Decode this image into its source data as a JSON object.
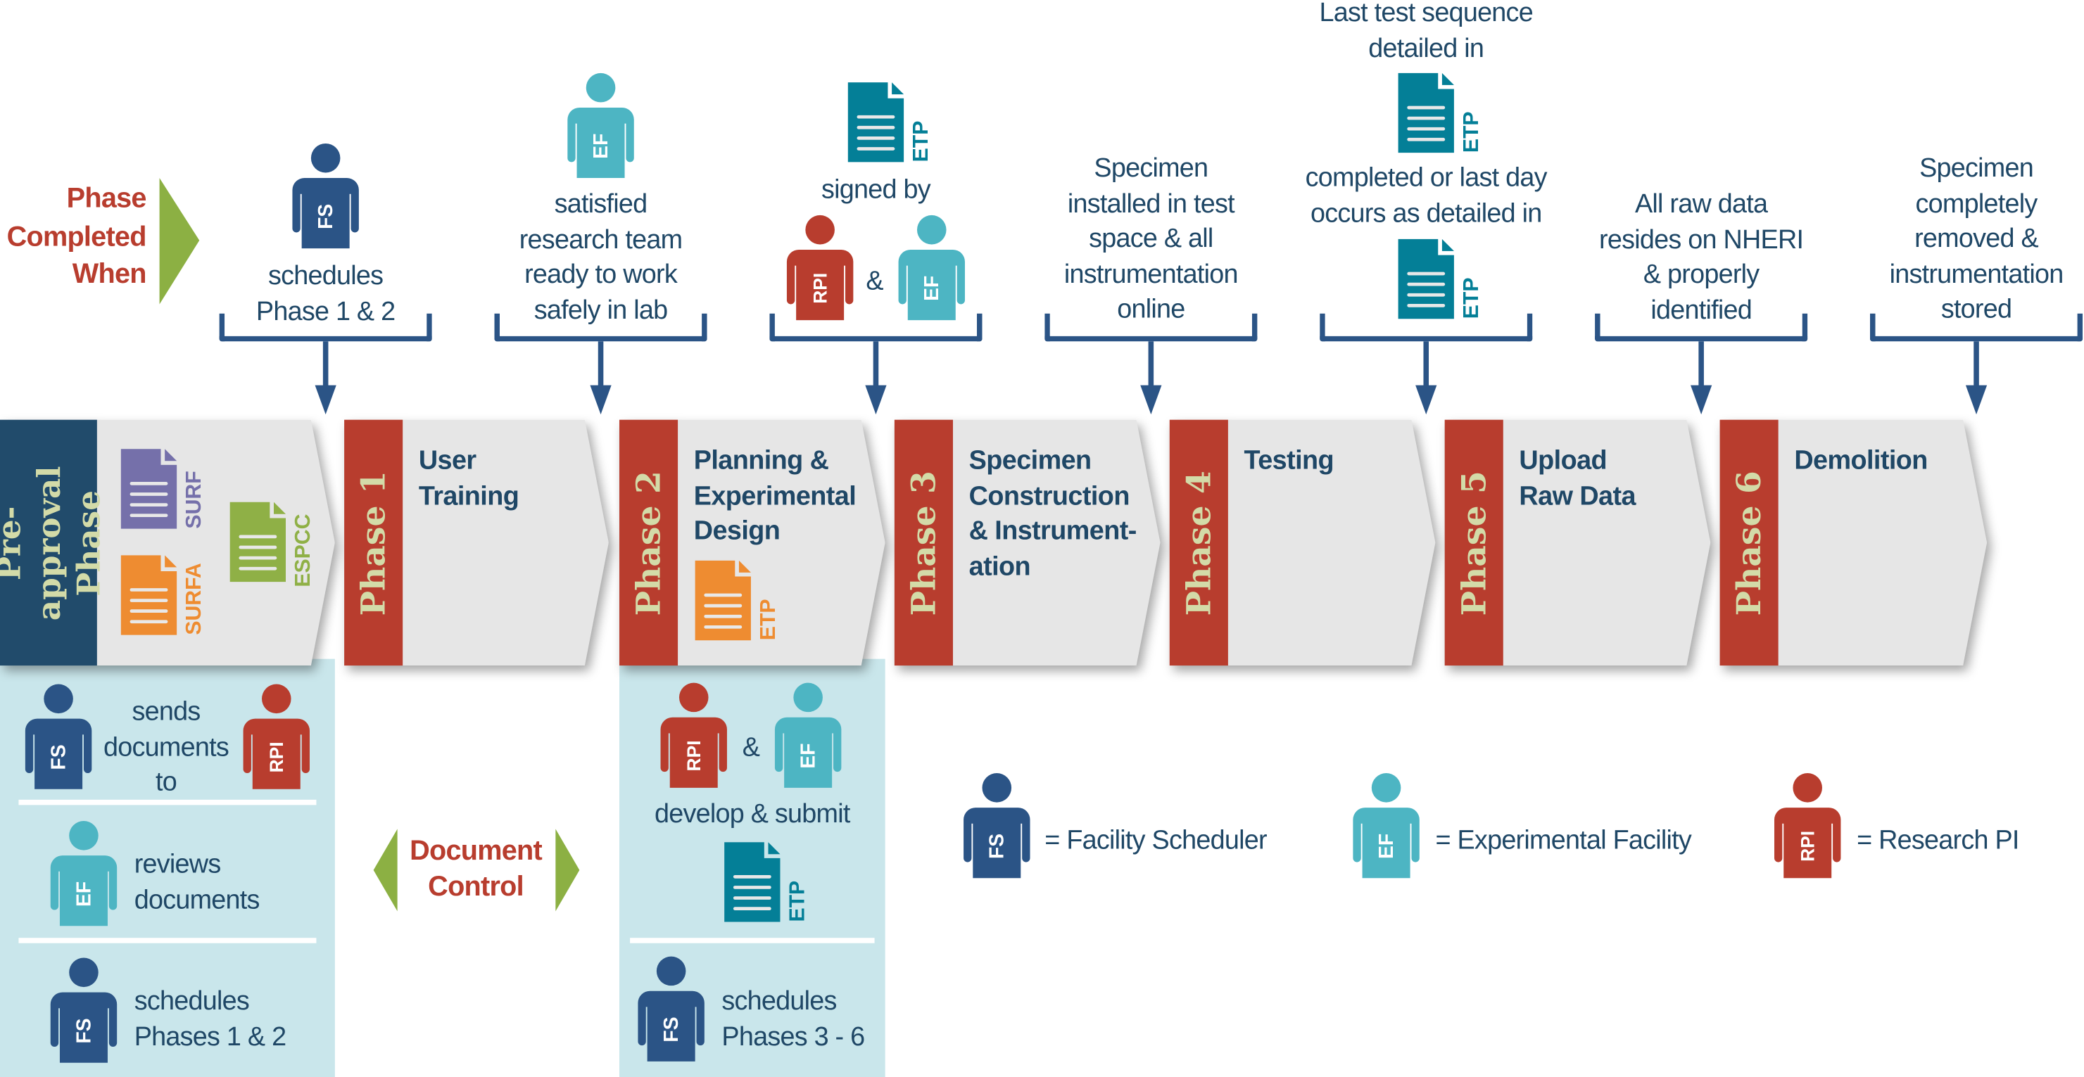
{
  "colors": {
    "facility_scheduler": "#2b5486",
    "experimental_facility": "#4db5c3",
    "research_pi": "#b83d2e",
    "phase_strip": "#b83d2e",
    "preapproval_strip": "#214b6b",
    "chevron_body": "#e6e6e6",
    "panel": "#c9e6eb",
    "etp_doc": "#047f97",
    "surf_doc": "#7570aa",
    "surfa_doc": "#ee8c31",
    "espcc_doc": "#8fb046",
    "accent_green": "#8cb043",
    "heading_red": "#b83d2e",
    "text": "#1f4766"
  },
  "roles": {
    "fs": {
      "abbr": "FS",
      "name": "Facility Scheduler"
    },
    "ef": {
      "abbr": "EF",
      "name": "Experimental Facility"
    },
    "rpi": {
      "abbr": "RPI",
      "name": "Research PI"
    }
  },
  "docs": {
    "etp": "ETP",
    "surf": "SURF",
    "surfa": "SURFA",
    "espcc": "ESPCC"
  },
  "header": {
    "phase_completed_when": "Phase\nCompleted\nWhen"
  },
  "document_control": "Document\nControl",
  "phases": [
    {
      "strip": "Pre-approval\nPhase",
      "title": ""
    },
    {
      "strip": "Phase 1",
      "title": "User\nTraining"
    },
    {
      "strip": "Phase 2",
      "title": "Planning &\nExperimental\nDesign"
    },
    {
      "strip": "Phase 3",
      "title": "Specimen\nConstruction\n& Instrument-\nation"
    },
    {
      "strip": "Phase 4",
      "title": "Testing"
    },
    {
      "strip": "Phase 5",
      "title": "Upload\nRaw Data"
    },
    {
      "strip": "Phase 6",
      "title": "Demolition"
    }
  ],
  "completion": {
    "phase1": "schedules\nPhase 1 & 2",
    "phase2": "satisfied\nresearch team\nready to work\nsafely in lab",
    "phase3_signed": "signed by",
    "amp": "&",
    "phase4": "Specimen\ninstalled in test\nspace & all\ninstrumentation\nonline",
    "phase5_top": "Last test sequence\ndetailed in",
    "phase5_mid": "completed or last day\noccurs as detailed in",
    "phase6": "All raw data\nresides on NHERI\n& properly\nidentified",
    "phase7": "Specimen\ncompletely\nremoved &\ninstrumentation\nstored"
  },
  "preapproval_panel": {
    "sends": "sends\ndocuments\nto",
    "reviews": "reviews\ndocuments",
    "schedules": "schedules\nPhases 1 & 2"
  },
  "phase2_panel": {
    "amp": "&",
    "develop": "develop & submit",
    "schedules": "schedules\nPhases 3 - 6"
  },
  "legend": {
    "fs": "=  Facility Scheduler",
    "ef": "=  Experimental Facility",
    "rpi": "=  Research PI"
  }
}
